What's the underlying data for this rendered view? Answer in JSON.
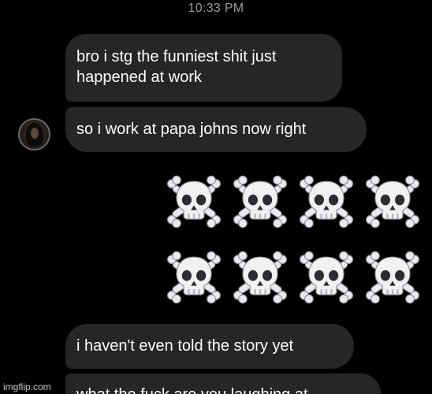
{
  "status": {
    "time": "10:33 PM"
  },
  "messages": [
    {
      "line1": "bro i stg the funniest shit just",
      "line2": "happened at work"
    },
    {
      "text": "so i work at papa johns now right"
    },
    {
      "emoji_name": "skull-and-crossbones",
      "count": 8
    },
    {
      "text": "i haven't even told the story yet"
    },
    {
      "text": "what the fuck are you laughing at"
    }
  ],
  "watermark": "imgflip.com",
  "colors": {
    "background": "#000000",
    "bubble": "#262626",
    "timestamp": "#9a9a9a"
  }
}
